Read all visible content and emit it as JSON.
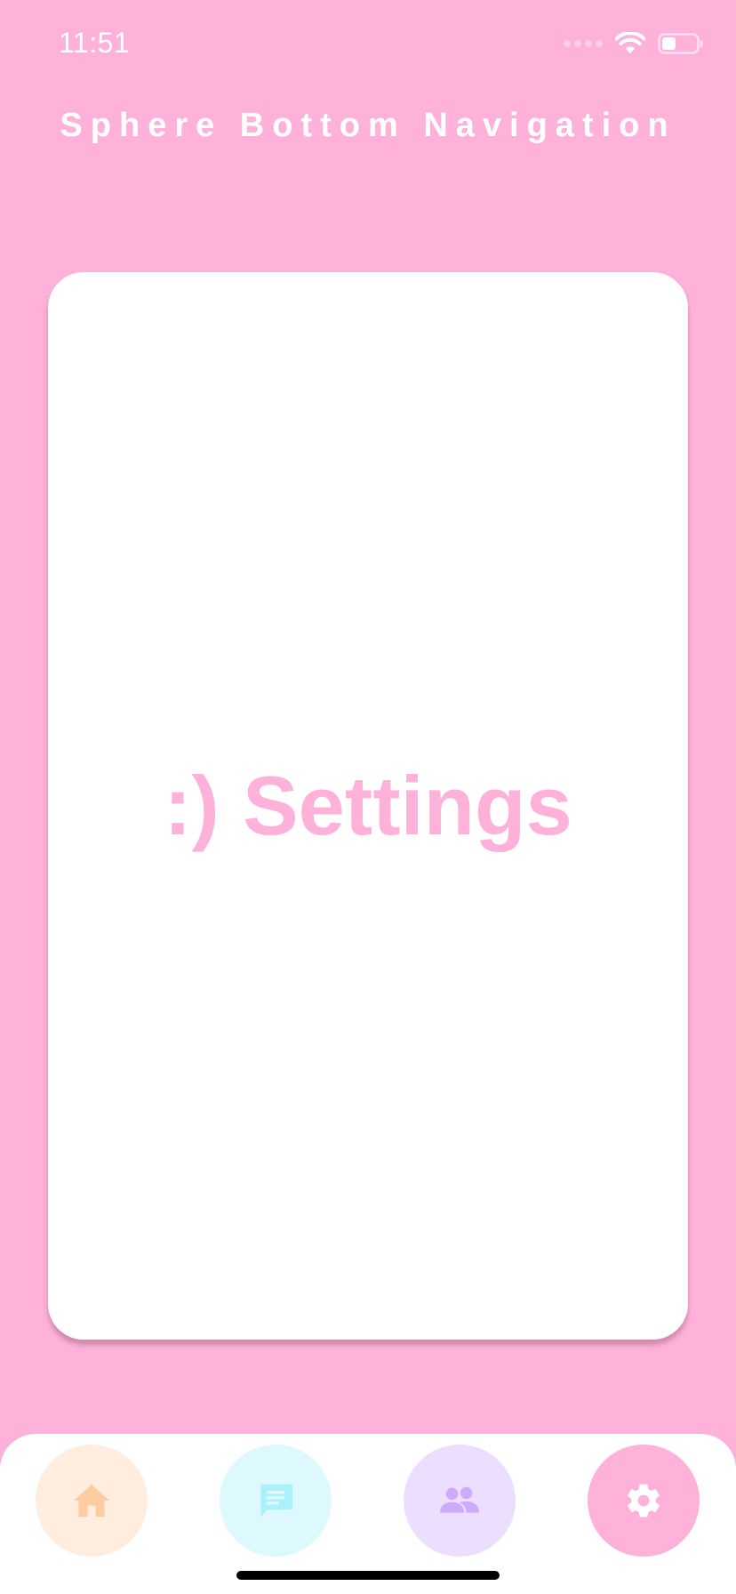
{
  "status_bar": {
    "time": "11:51",
    "icons": [
      "signal-icon",
      "wifi-icon",
      "battery-icon"
    ]
  },
  "header": {
    "title": "Sphere Bottom Navigation"
  },
  "card": {
    "text": ":) Settings"
  },
  "bottom_nav": {
    "items": [
      {
        "icon": "home-icon",
        "bg": "#FFEEE0",
        "fg": "#FFCBA1",
        "selected": false
      },
      {
        "icon": "chat-icon",
        "bg": "#DEF9FD",
        "fg": "#AAF2FB",
        "selected": false
      },
      {
        "icon": "people-icon",
        "bg": "#EBDEFF",
        "fg": "#CDABFC",
        "selected": false
      },
      {
        "icon": "gear-icon",
        "bg": "#FFB2D9",
        "fg": "#FFFFFF",
        "selected": true
      }
    ]
  },
  "colors": {
    "background": "#FFB2D9",
    "accent": "#FFB2D9",
    "card": "#FFFFFF"
  }
}
